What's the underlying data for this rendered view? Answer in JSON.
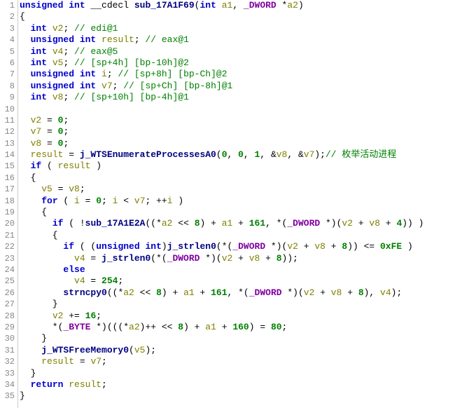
{
  "lines": [
    {
      "n": 1,
      "tokens": [
        [
          "kw",
          "unsigned int"
        ],
        [
          "op",
          " __cdecl "
        ],
        [
          "fn",
          "sub_17A1F69"
        ],
        [
          "op",
          "("
        ],
        [
          "kw",
          "int"
        ],
        [
          "op",
          " "
        ],
        [
          "var",
          "a1"
        ],
        [
          "op",
          ", "
        ],
        [
          "type",
          "_DWORD"
        ],
        [
          "op",
          " *"
        ],
        [
          "var",
          "a2"
        ],
        [
          "op",
          ")"
        ]
      ]
    },
    {
      "n": 2,
      "tokens": [
        [
          "op",
          "{"
        ]
      ]
    },
    {
      "n": 3,
      "tokens": [
        [
          "op",
          "  "
        ],
        [
          "kw",
          "int"
        ],
        [
          "op",
          " "
        ],
        [
          "var",
          "v2"
        ],
        [
          "op",
          "; "
        ],
        [
          "cmt",
          "// edi@1"
        ]
      ]
    },
    {
      "n": 4,
      "tokens": [
        [
          "op",
          "  "
        ],
        [
          "kw",
          "unsigned int"
        ],
        [
          "op",
          " "
        ],
        [
          "var",
          "result"
        ],
        [
          "op",
          "; "
        ],
        [
          "cmt",
          "// eax@1"
        ]
      ]
    },
    {
      "n": 5,
      "tokens": [
        [
          "op",
          "  "
        ],
        [
          "kw",
          "int"
        ],
        [
          "op",
          " "
        ],
        [
          "var",
          "v4"
        ],
        [
          "op",
          "; "
        ],
        [
          "cmt",
          "// eax@5"
        ]
      ]
    },
    {
      "n": 6,
      "tokens": [
        [
          "op",
          "  "
        ],
        [
          "kw",
          "int"
        ],
        [
          "op",
          " "
        ],
        [
          "var",
          "v5"
        ],
        [
          "op",
          "; "
        ],
        [
          "cmt",
          "// [sp+4h] [bp-10h]@2"
        ]
      ]
    },
    {
      "n": 7,
      "tokens": [
        [
          "op",
          "  "
        ],
        [
          "kw",
          "unsigned int"
        ],
        [
          "op",
          " "
        ],
        [
          "var",
          "i"
        ],
        [
          "op",
          "; "
        ],
        [
          "cmt",
          "// [sp+8h] [bp-Ch]@2"
        ]
      ]
    },
    {
      "n": 8,
      "tokens": [
        [
          "op",
          "  "
        ],
        [
          "kw",
          "unsigned int"
        ],
        [
          "op",
          " "
        ],
        [
          "var",
          "v7"
        ],
        [
          "op",
          "; "
        ],
        [
          "cmt",
          "// [sp+Ch] [bp-8h]@1"
        ]
      ]
    },
    {
      "n": 9,
      "tokens": [
        [
          "op",
          "  "
        ],
        [
          "kw",
          "int"
        ],
        [
          "op",
          " "
        ],
        [
          "var",
          "v8"
        ],
        [
          "op",
          "; "
        ],
        [
          "cmt",
          "// [sp+10h] [bp-4h]@1"
        ]
      ]
    },
    {
      "n": 10,
      "tokens": [
        [
          "op",
          ""
        ]
      ]
    },
    {
      "n": 11,
      "tokens": [
        [
          "op",
          "  "
        ],
        [
          "var",
          "v2"
        ],
        [
          "op",
          " = "
        ],
        [
          "num",
          "0"
        ],
        [
          "op",
          ";"
        ]
      ]
    },
    {
      "n": 12,
      "tokens": [
        [
          "op",
          "  "
        ],
        [
          "var",
          "v7"
        ],
        [
          "op",
          " = "
        ],
        [
          "num",
          "0"
        ],
        [
          "op",
          ";"
        ]
      ]
    },
    {
      "n": 13,
      "tokens": [
        [
          "op",
          "  "
        ],
        [
          "var",
          "v8"
        ],
        [
          "op",
          " = "
        ],
        [
          "num",
          "0"
        ],
        [
          "op",
          ";"
        ]
      ]
    },
    {
      "n": 14,
      "tokens": [
        [
          "op",
          "  "
        ],
        [
          "var",
          "result"
        ],
        [
          "op",
          " = "
        ],
        [
          "fn",
          "j_WTSEnumerateProcessesA0"
        ],
        [
          "op",
          "("
        ],
        [
          "num",
          "0"
        ],
        [
          "op",
          ", "
        ],
        [
          "num",
          "0"
        ],
        [
          "op",
          ", "
        ],
        [
          "num",
          "1"
        ],
        [
          "op",
          ", &"
        ],
        [
          "var",
          "v8"
        ],
        [
          "op",
          ", &"
        ],
        [
          "var",
          "v7"
        ],
        [
          "op",
          ");"
        ],
        [
          "cmtcn",
          "// 枚举活动进程"
        ]
      ]
    },
    {
      "n": 15,
      "tokens": [
        [
          "op",
          "  "
        ],
        [
          "kw",
          "if"
        ],
        [
          "op",
          " ( "
        ],
        [
          "var",
          "result"
        ],
        [
          "op",
          " )"
        ]
      ]
    },
    {
      "n": 16,
      "tokens": [
        [
          "op",
          "  {"
        ]
      ]
    },
    {
      "n": 17,
      "tokens": [
        [
          "op",
          "    "
        ],
        [
          "var",
          "v5"
        ],
        [
          "op",
          " = "
        ],
        [
          "var",
          "v8"
        ],
        [
          "op",
          ";"
        ]
      ]
    },
    {
      "n": 18,
      "tokens": [
        [
          "op",
          "    "
        ],
        [
          "kw",
          "for"
        ],
        [
          "op",
          " ( "
        ],
        [
          "var",
          "i"
        ],
        [
          "op",
          " = "
        ],
        [
          "num",
          "0"
        ],
        [
          "op",
          "; "
        ],
        [
          "var",
          "i"
        ],
        [
          "op",
          " < "
        ],
        [
          "var",
          "v7"
        ],
        [
          "op",
          "; ++"
        ],
        [
          "var",
          "i"
        ],
        [
          "op",
          " )"
        ]
      ]
    },
    {
      "n": 19,
      "tokens": [
        [
          "op",
          "    {"
        ]
      ]
    },
    {
      "n": 20,
      "tokens": [
        [
          "op",
          "      "
        ],
        [
          "kw",
          "if"
        ],
        [
          "op",
          " ( !"
        ],
        [
          "fn",
          "sub_17A1E2A"
        ],
        [
          "op",
          "((*"
        ],
        [
          "var",
          "a2"
        ],
        [
          "op",
          " << "
        ],
        [
          "num",
          "8"
        ],
        [
          "op",
          ") + "
        ],
        [
          "var",
          "a1"
        ],
        [
          "op",
          " + "
        ],
        [
          "num",
          "161"
        ],
        [
          "op",
          ", *("
        ],
        [
          "type",
          "_DWORD"
        ],
        [
          "op",
          " *)("
        ],
        [
          "var",
          "v2"
        ],
        [
          "op",
          " + "
        ],
        [
          "var",
          "v8"
        ],
        [
          "op",
          " + "
        ],
        [
          "num",
          "4"
        ],
        [
          "op",
          ")) )"
        ]
      ]
    },
    {
      "n": 21,
      "tokens": [
        [
          "op",
          "      {"
        ]
      ]
    },
    {
      "n": 22,
      "tokens": [
        [
          "op",
          "        "
        ],
        [
          "kw",
          "if"
        ],
        [
          "op",
          " ( ("
        ],
        [
          "kw",
          "unsigned int"
        ],
        [
          "op",
          ")"
        ],
        [
          "fn",
          "j_strlen0"
        ],
        [
          "op",
          "(*("
        ],
        [
          "type",
          "_DWORD"
        ],
        [
          "op",
          " *)("
        ],
        [
          "var",
          "v2"
        ],
        [
          "op",
          " + "
        ],
        [
          "var",
          "v8"
        ],
        [
          "op",
          " + "
        ],
        [
          "num",
          "8"
        ],
        [
          "op",
          ")) <= "
        ],
        [
          "num",
          "0xFE"
        ],
        [
          "op",
          " )"
        ]
      ]
    },
    {
      "n": 23,
      "tokens": [
        [
          "op",
          "          "
        ],
        [
          "var",
          "v4"
        ],
        [
          "op",
          " = "
        ],
        [
          "fn",
          "j_strlen0"
        ],
        [
          "op",
          "(*("
        ],
        [
          "type",
          "_DWORD"
        ],
        [
          "op",
          " *)("
        ],
        [
          "var",
          "v2"
        ],
        [
          "op",
          " + "
        ],
        [
          "var",
          "v8"
        ],
        [
          "op",
          " + "
        ],
        [
          "num",
          "8"
        ],
        [
          "op",
          "));"
        ]
      ]
    },
    {
      "n": 24,
      "tokens": [
        [
          "op",
          "        "
        ],
        [
          "kw",
          "else"
        ]
      ]
    },
    {
      "n": 25,
      "tokens": [
        [
          "op",
          "          "
        ],
        [
          "var",
          "v4"
        ],
        [
          "op",
          " = "
        ],
        [
          "num",
          "254"
        ],
        [
          "op",
          ";"
        ]
      ]
    },
    {
      "n": 26,
      "tokens": [
        [
          "op",
          "        "
        ],
        [
          "fn",
          "strncpy0"
        ],
        [
          "op",
          "((*"
        ],
        [
          "var",
          "a2"
        ],
        [
          "op",
          " << "
        ],
        [
          "num",
          "8"
        ],
        [
          "op",
          ") + "
        ],
        [
          "var",
          "a1"
        ],
        [
          "op",
          " + "
        ],
        [
          "num",
          "161"
        ],
        [
          "op",
          ", *("
        ],
        [
          "type",
          "_DWORD"
        ],
        [
          "op",
          " *)("
        ],
        [
          "var",
          "v2"
        ],
        [
          "op",
          " + "
        ],
        [
          "var",
          "v8"
        ],
        [
          "op",
          " + "
        ],
        [
          "num",
          "8"
        ],
        [
          "op",
          "), "
        ],
        [
          "var",
          "v4"
        ],
        [
          "op",
          ");"
        ]
      ]
    },
    {
      "n": 27,
      "tokens": [
        [
          "op",
          "      }"
        ]
      ]
    },
    {
      "n": 28,
      "tokens": [
        [
          "op",
          "      "
        ],
        [
          "var",
          "v2"
        ],
        [
          "op",
          " += "
        ],
        [
          "num",
          "16"
        ],
        [
          "op",
          ";"
        ]
      ]
    },
    {
      "n": 29,
      "tokens": [
        [
          "op",
          "      *("
        ],
        [
          "type",
          "_BYTE"
        ],
        [
          "op",
          " *)(((*"
        ],
        [
          "var",
          "a2"
        ],
        [
          "op",
          ")++ << "
        ],
        [
          "num",
          "8"
        ],
        [
          "op",
          ") + "
        ],
        [
          "var",
          "a1"
        ],
        [
          "op",
          " + "
        ],
        [
          "num",
          "160"
        ],
        [
          "op",
          ") = "
        ],
        [
          "num",
          "80"
        ],
        [
          "op",
          ";"
        ]
      ]
    },
    {
      "n": 30,
      "tokens": [
        [
          "op",
          "    }"
        ]
      ]
    },
    {
      "n": 31,
      "tokens": [
        [
          "op",
          "    "
        ],
        [
          "fn",
          "j_WTSFreeMemory0"
        ],
        [
          "op",
          "("
        ],
        [
          "var",
          "v5"
        ],
        [
          "op",
          ");"
        ]
      ]
    },
    {
      "n": 32,
      "tokens": [
        [
          "op",
          "    "
        ],
        [
          "var",
          "result"
        ],
        [
          "op",
          " = "
        ],
        [
          "var",
          "v7"
        ],
        [
          "op",
          ";"
        ]
      ]
    },
    {
      "n": 33,
      "tokens": [
        [
          "op",
          "  }"
        ]
      ]
    },
    {
      "n": 34,
      "tokens": [
        [
          "op",
          "  "
        ],
        [
          "kw",
          "return"
        ],
        [
          "op",
          " "
        ],
        [
          "var",
          "result"
        ],
        [
          "op",
          ";"
        ]
      ]
    },
    {
      "n": 35,
      "tokens": [
        [
          "op",
          "}"
        ]
      ]
    }
  ]
}
